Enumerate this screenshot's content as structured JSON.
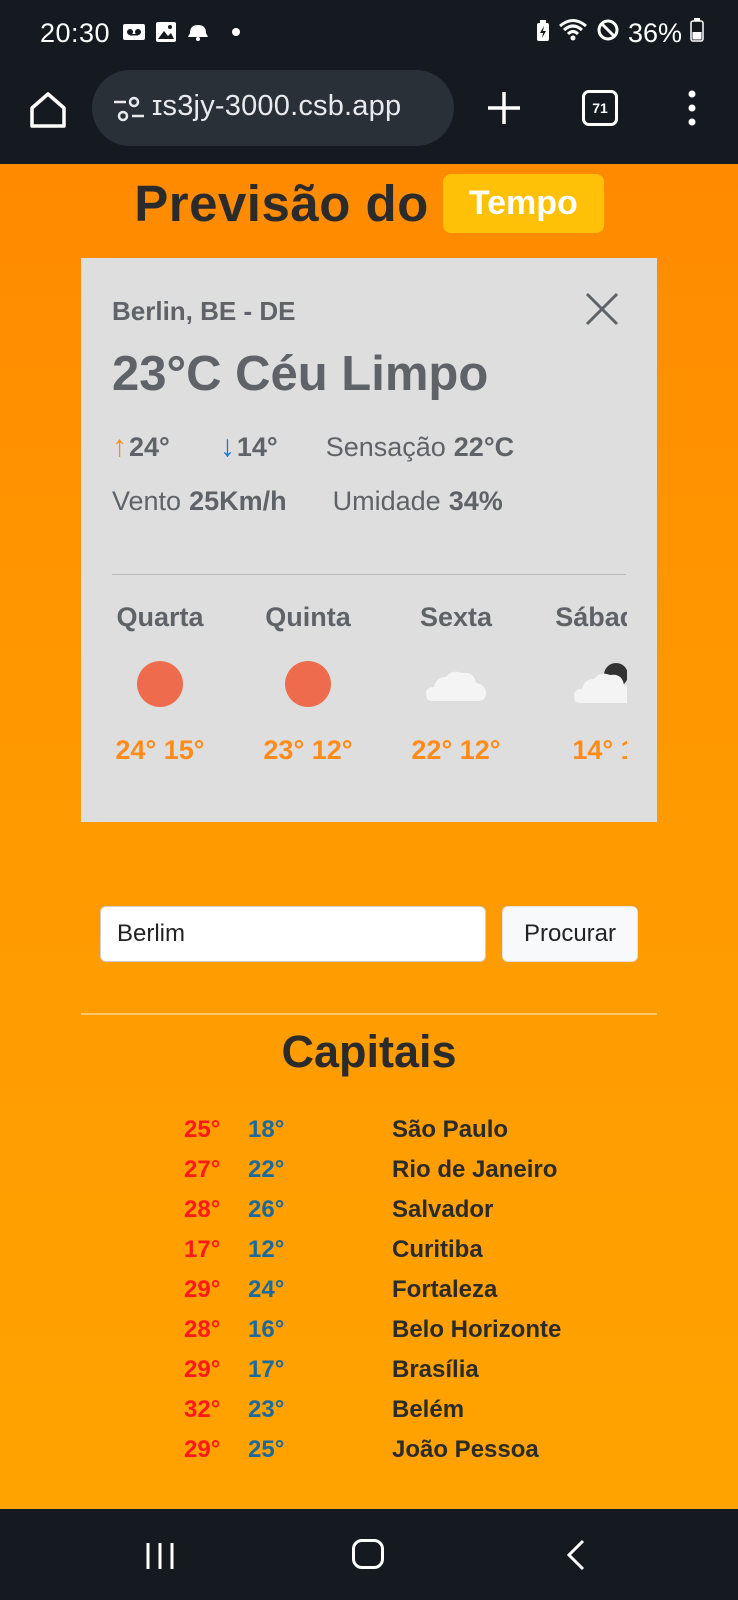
{
  "status_bar": {
    "time": "20:30",
    "battery": "36%"
  },
  "browser": {
    "url": "ɪs3jy-3000.csb.app",
    "tab_count": "71"
  },
  "header": {
    "title": "Previsão do",
    "badge": "Tempo"
  },
  "weather": {
    "city": "Berlin, BE - DE",
    "temp_line": "23°C Céu Limpo",
    "max": "24°",
    "min": "14°",
    "feels_label": "Sensação",
    "feels_value": "22°C",
    "wind_label": "Vento",
    "wind_value": "25Km/h",
    "humidity_label": "Umidade",
    "humidity_value": "34%",
    "forecast": [
      {
        "day": "Quarta",
        "icon": "sun-icon",
        "temps": "24° 15°"
      },
      {
        "day": "Quinta",
        "icon": "sun-icon",
        "temps": "23° 12°"
      },
      {
        "day": "Sexta",
        "icon": "cloud-icon",
        "temps": "22° 12°"
      },
      {
        "day": "Sábado",
        "icon": "cloud-night-icon",
        "temps": "14° 1"
      }
    ]
  },
  "search": {
    "value": "Berlim",
    "button_label": "Procurar"
  },
  "capitals": {
    "title": "Capitais",
    "rows": [
      {
        "max": "25°",
        "min": "18°",
        "name": "São Paulo"
      },
      {
        "max": "27°",
        "min": "22°",
        "name": "Rio de Janeiro"
      },
      {
        "max": "28°",
        "min": "26°",
        "name": "Salvador"
      },
      {
        "max": "17°",
        "min": "12°",
        "name": "Curitiba"
      },
      {
        "max": "29°",
        "min": "24°",
        "name": "Fortaleza"
      },
      {
        "max": "28°",
        "min": "16°",
        "name": "Belo Horizonte"
      },
      {
        "max": "29°",
        "min": "17°",
        "name": "Brasília"
      },
      {
        "max": "32°",
        "min": "23°",
        "name": "Belém"
      },
      {
        "max": "29°",
        "min": "25°",
        "name": "João Pessoa"
      }
    ]
  },
  "colors": {
    "background_top": "#ff8a00",
    "background_bottom": "#ffa300",
    "badge": "#ffc107",
    "forecast_temp": "#ff8c1a",
    "capital_max": "#ff1a1a",
    "capital_min": "#1a6aa0"
  }
}
